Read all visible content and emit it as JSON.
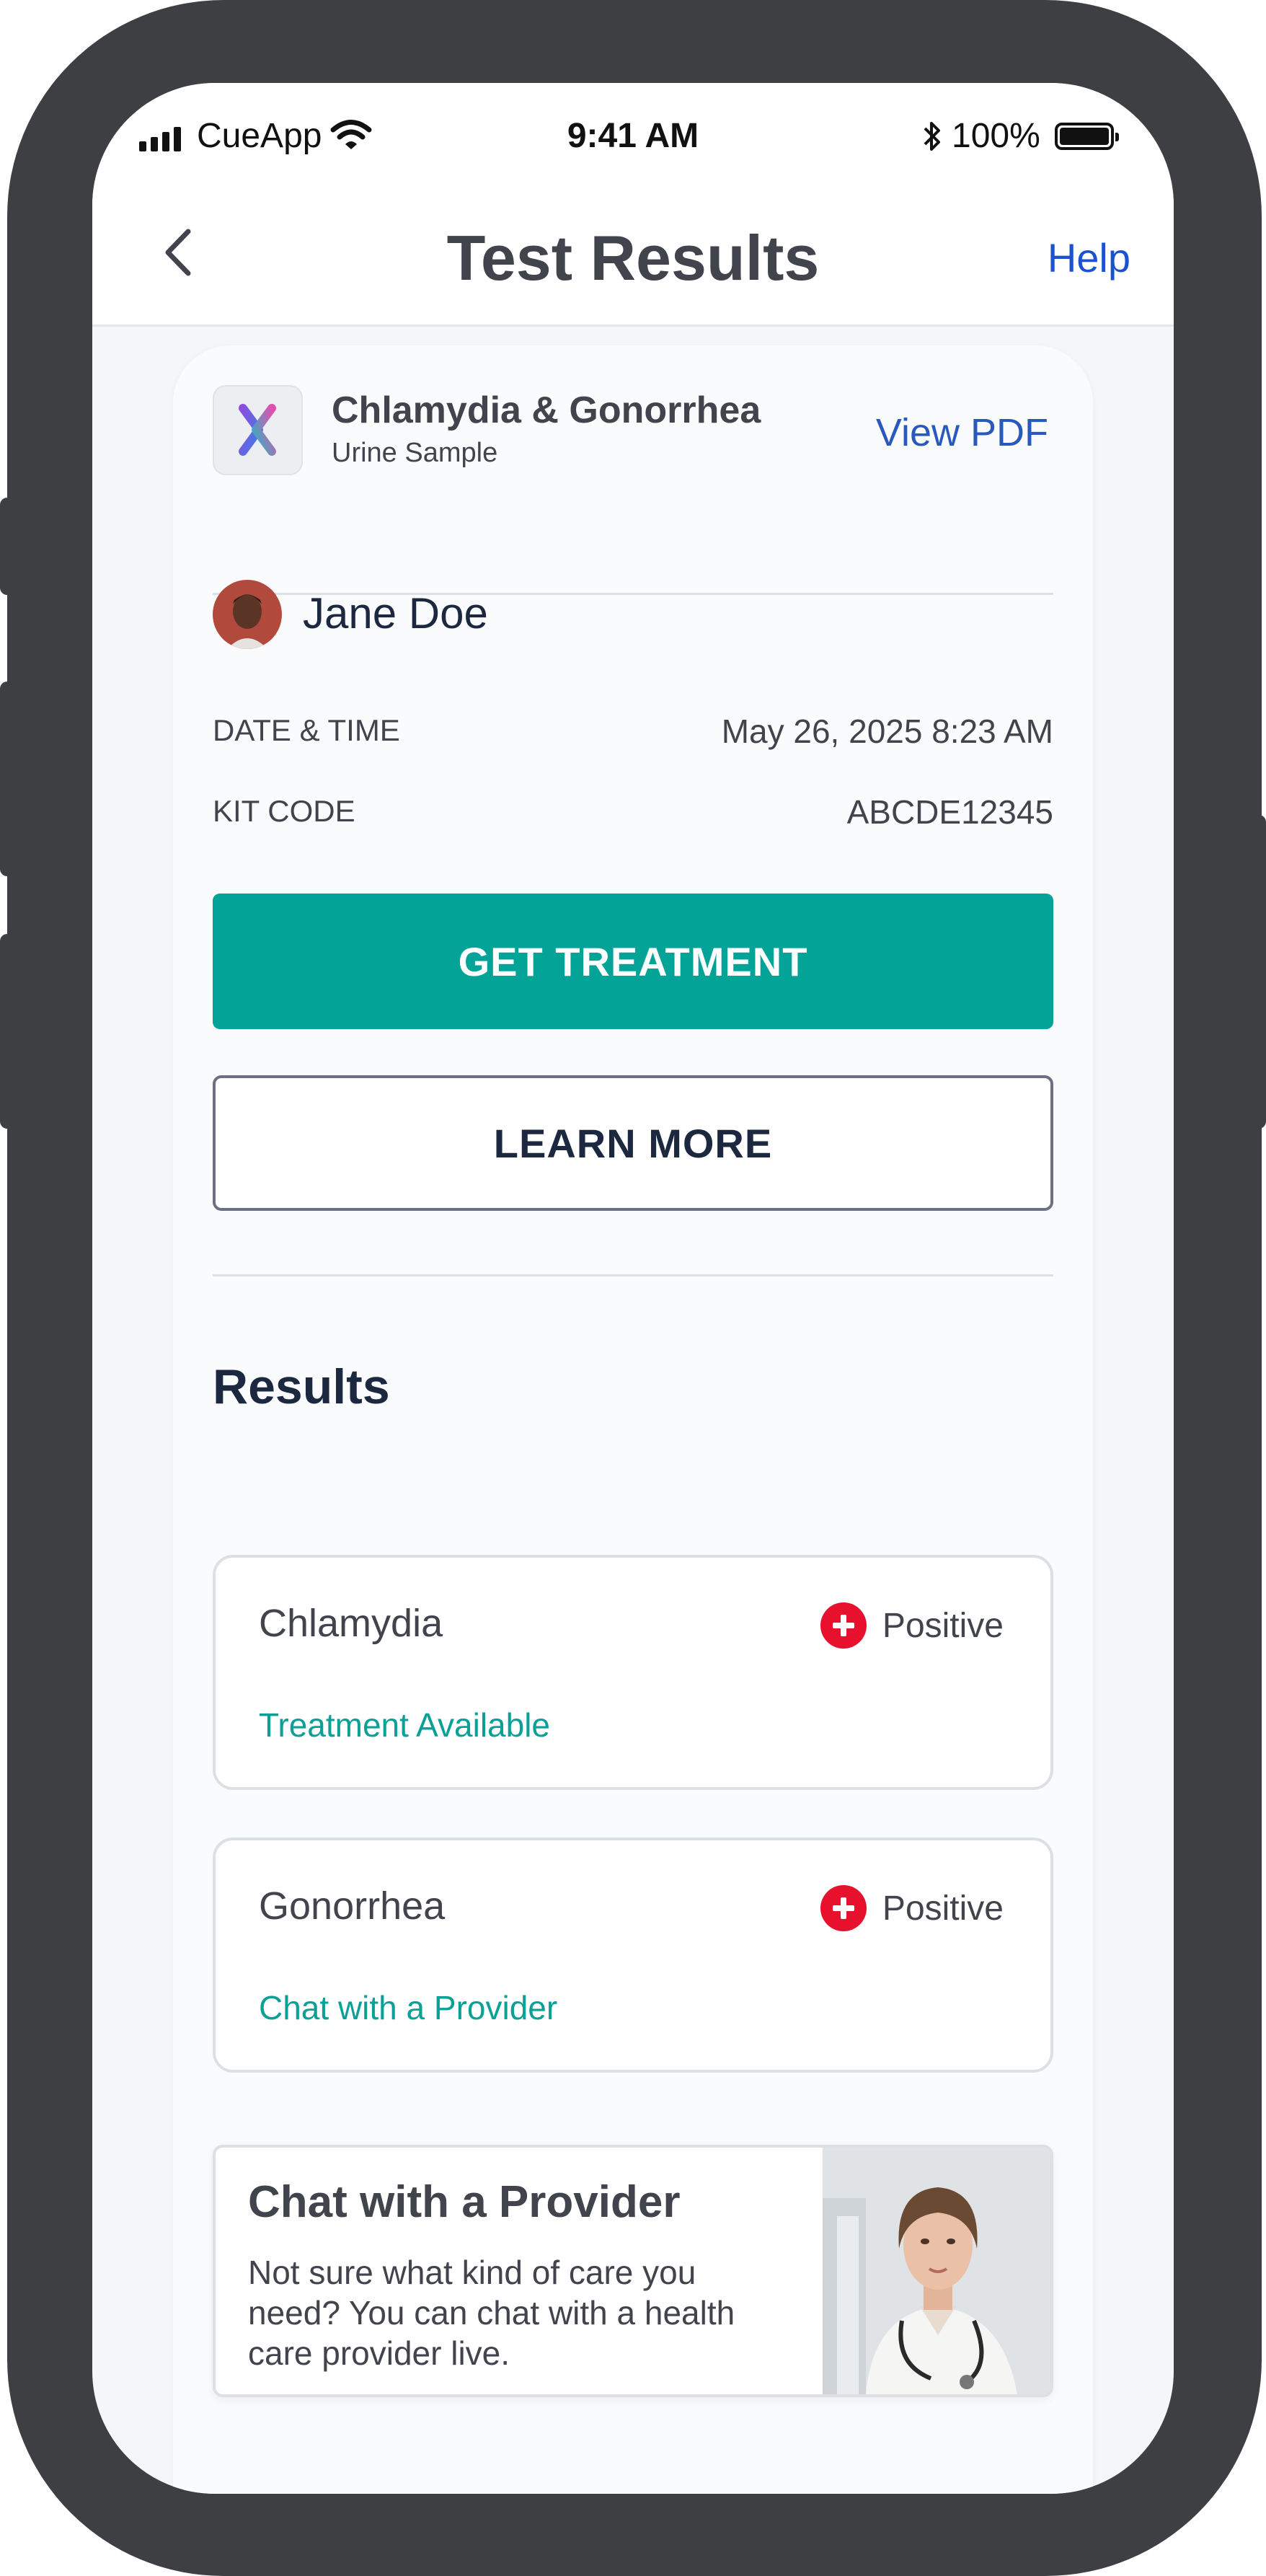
{
  "status_bar": {
    "carrier": "CueApp",
    "time": "9:41 AM",
    "battery": "100%"
  },
  "nav": {
    "title": "Test Results",
    "help": "Help"
  },
  "test": {
    "name": "Chlamydia & Gonorrhea",
    "sample": "Urine Sample",
    "view_pdf": "View PDF"
  },
  "user": {
    "name": "Jane Doe"
  },
  "details": [
    {
      "label": "DATE & TIME",
      "value": "May 26, 2025 8:23 AM"
    },
    {
      "label": "KIT CODE",
      "value": "ABCDE12345"
    }
  ],
  "actions": {
    "primary": "GET TREATMENT",
    "secondary": "LEARN MORE"
  },
  "results": {
    "title": "Results",
    "items": [
      {
        "name": "Chlamydia",
        "status": "Positive",
        "link": "Treatment Available"
      },
      {
        "name": "Gonorrhea",
        "status": "Positive",
        "link": "Chat with a Provider"
      }
    ]
  },
  "promo": {
    "title": "Chat with a Provider",
    "body": "Not sure what kind of care you need? You can chat with a health care provider live."
  },
  "colors": {
    "accent_teal": "#03a497",
    "link_blue": "#1c52cf",
    "positive_red": "#e8112d",
    "text_dark": "#41434d"
  }
}
